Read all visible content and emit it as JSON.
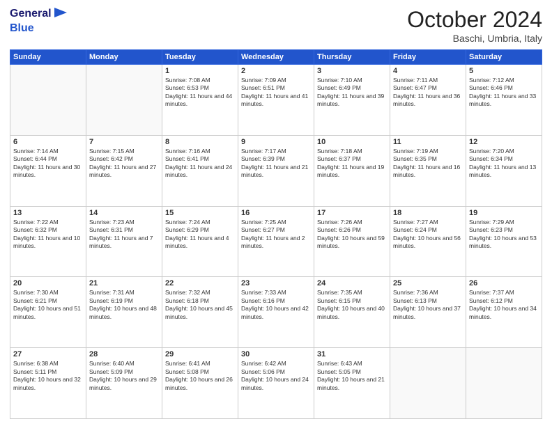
{
  "header": {
    "logo_general": "General",
    "logo_blue": "Blue",
    "title": "October 2024",
    "location": "Baschi, Umbria, Italy"
  },
  "weekdays": [
    "Sunday",
    "Monday",
    "Tuesday",
    "Wednesday",
    "Thursday",
    "Friday",
    "Saturday"
  ],
  "weeks": [
    [
      {
        "day": "",
        "sunrise": "",
        "sunset": "",
        "daylight": ""
      },
      {
        "day": "",
        "sunrise": "",
        "sunset": "",
        "daylight": ""
      },
      {
        "day": "1",
        "sunrise": "Sunrise: 7:08 AM",
        "sunset": "Sunset: 6:53 PM",
        "daylight": "Daylight: 11 hours and 44 minutes."
      },
      {
        "day": "2",
        "sunrise": "Sunrise: 7:09 AM",
        "sunset": "Sunset: 6:51 PM",
        "daylight": "Daylight: 11 hours and 41 minutes."
      },
      {
        "day": "3",
        "sunrise": "Sunrise: 7:10 AM",
        "sunset": "Sunset: 6:49 PM",
        "daylight": "Daylight: 11 hours and 39 minutes."
      },
      {
        "day": "4",
        "sunrise": "Sunrise: 7:11 AM",
        "sunset": "Sunset: 6:47 PM",
        "daylight": "Daylight: 11 hours and 36 minutes."
      },
      {
        "day": "5",
        "sunrise": "Sunrise: 7:12 AM",
        "sunset": "Sunset: 6:46 PM",
        "daylight": "Daylight: 11 hours and 33 minutes."
      }
    ],
    [
      {
        "day": "6",
        "sunrise": "Sunrise: 7:14 AM",
        "sunset": "Sunset: 6:44 PM",
        "daylight": "Daylight: 11 hours and 30 minutes."
      },
      {
        "day": "7",
        "sunrise": "Sunrise: 7:15 AM",
        "sunset": "Sunset: 6:42 PM",
        "daylight": "Daylight: 11 hours and 27 minutes."
      },
      {
        "day": "8",
        "sunrise": "Sunrise: 7:16 AM",
        "sunset": "Sunset: 6:41 PM",
        "daylight": "Daylight: 11 hours and 24 minutes."
      },
      {
        "day": "9",
        "sunrise": "Sunrise: 7:17 AM",
        "sunset": "Sunset: 6:39 PM",
        "daylight": "Daylight: 11 hours and 21 minutes."
      },
      {
        "day": "10",
        "sunrise": "Sunrise: 7:18 AM",
        "sunset": "Sunset: 6:37 PM",
        "daylight": "Daylight: 11 hours and 19 minutes."
      },
      {
        "day": "11",
        "sunrise": "Sunrise: 7:19 AM",
        "sunset": "Sunset: 6:35 PM",
        "daylight": "Daylight: 11 hours and 16 minutes."
      },
      {
        "day": "12",
        "sunrise": "Sunrise: 7:20 AM",
        "sunset": "Sunset: 6:34 PM",
        "daylight": "Daylight: 11 hours and 13 minutes."
      }
    ],
    [
      {
        "day": "13",
        "sunrise": "Sunrise: 7:22 AM",
        "sunset": "Sunset: 6:32 PM",
        "daylight": "Daylight: 11 hours and 10 minutes."
      },
      {
        "day": "14",
        "sunrise": "Sunrise: 7:23 AM",
        "sunset": "Sunset: 6:31 PM",
        "daylight": "Daylight: 11 hours and 7 minutes."
      },
      {
        "day": "15",
        "sunrise": "Sunrise: 7:24 AM",
        "sunset": "Sunset: 6:29 PM",
        "daylight": "Daylight: 11 hours and 4 minutes."
      },
      {
        "day": "16",
        "sunrise": "Sunrise: 7:25 AM",
        "sunset": "Sunset: 6:27 PM",
        "daylight": "Daylight: 11 hours and 2 minutes."
      },
      {
        "day": "17",
        "sunrise": "Sunrise: 7:26 AM",
        "sunset": "Sunset: 6:26 PM",
        "daylight": "Daylight: 10 hours and 59 minutes."
      },
      {
        "day": "18",
        "sunrise": "Sunrise: 7:27 AM",
        "sunset": "Sunset: 6:24 PM",
        "daylight": "Daylight: 10 hours and 56 minutes."
      },
      {
        "day": "19",
        "sunrise": "Sunrise: 7:29 AM",
        "sunset": "Sunset: 6:23 PM",
        "daylight": "Daylight: 10 hours and 53 minutes."
      }
    ],
    [
      {
        "day": "20",
        "sunrise": "Sunrise: 7:30 AM",
        "sunset": "Sunset: 6:21 PM",
        "daylight": "Daylight: 10 hours and 51 minutes."
      },
      {
        "day": "21",
        "sunrise": "Sunrise: 7:31 AM",
        "sunset": "Sunset: 6:19 PM",
        "daylight": "Daylight: 10 hours and 48 minutes."
      },
      {
        "day": "22",
        "sunrise": "Sunrise: 7:32 AM",
        "sunset": "Sunset: 6:18 PM",
        "daylight": "Daylight: 10 hours and 45 minutes."
      },
      {
        "day": "23",
        "sunrise": "Sunrise: 7:33 AM",
        "sunset": "Sunset: 6:16 PM",
        "daylight": "Daylight: 10 hours and 42 minutes."
      },
      {
        "day": "24",
        "sunrise": "Sunrise: 7:35 AM",
        "sunset": "Sunset: 6:15 PM",
        "daylight": "Daylight: 10 hours and 40 minutes."
      },
      {
        "day": "25",
        "sunrise": "Sunrise: 7:36 AM",
        "sunset": "Sunset: 6:13 PM",
        "daylight": "Daylight: 10 hours and 37 minutes."
      },
      {
        "day": "26",
        "sunrise": "Sunrise: 7:37 AM",
        "sunset": "Sunset: 6:12 PM",
        "daylight": "Daylight: 10 hours and 34 minutes."
      }
    ],
    [
      {
        "day": "27",
        "sunrise": "Sunrise: 6:38 AM",
        "sunset": "Sunset: 5:11 PM",
        "daylight": "Daylight: 10 hours and 32 minutes."
      },
      {
        "day": "28",
        "sunrise": "Sunrise: 6:40 AM",
        "sunset": "Sunset: 5:09 PM",
        "daylight": "Daylight: 10 hours and 29 minutes."
      },
      {
        "day": "29",
        "sunrise": "Sunrise: 6:41 AM",
        "sunset": "Sunset: 5:08 PM",
        "daylight": "Daylight: 10 hours and 26 minutes."
      },
      {
        "day": "30",
        "sunrise": "Sunrise: 6:42 AM",
        "sunset": "Sunset: 5:06 PM",
        "daylight": "Daylight: 10 hours and 24 minutes."
      },
      {
        "day": "31",
        "sunrise": "Sunrise: 6:43 AM",
        "sunset": "Sunset: 5:05 PM",
        "daylight": "Daylight: 10 hours and 21 minutes."
      },
      {
        "day": "",
        "sunrise": "",
        "sunset": "",
        "daylight": ""
      },
      {
        "day": "",
        "sunrise": "",
        "sunset": "",
        "daylight": ""
      }
    ]
  ]
}
